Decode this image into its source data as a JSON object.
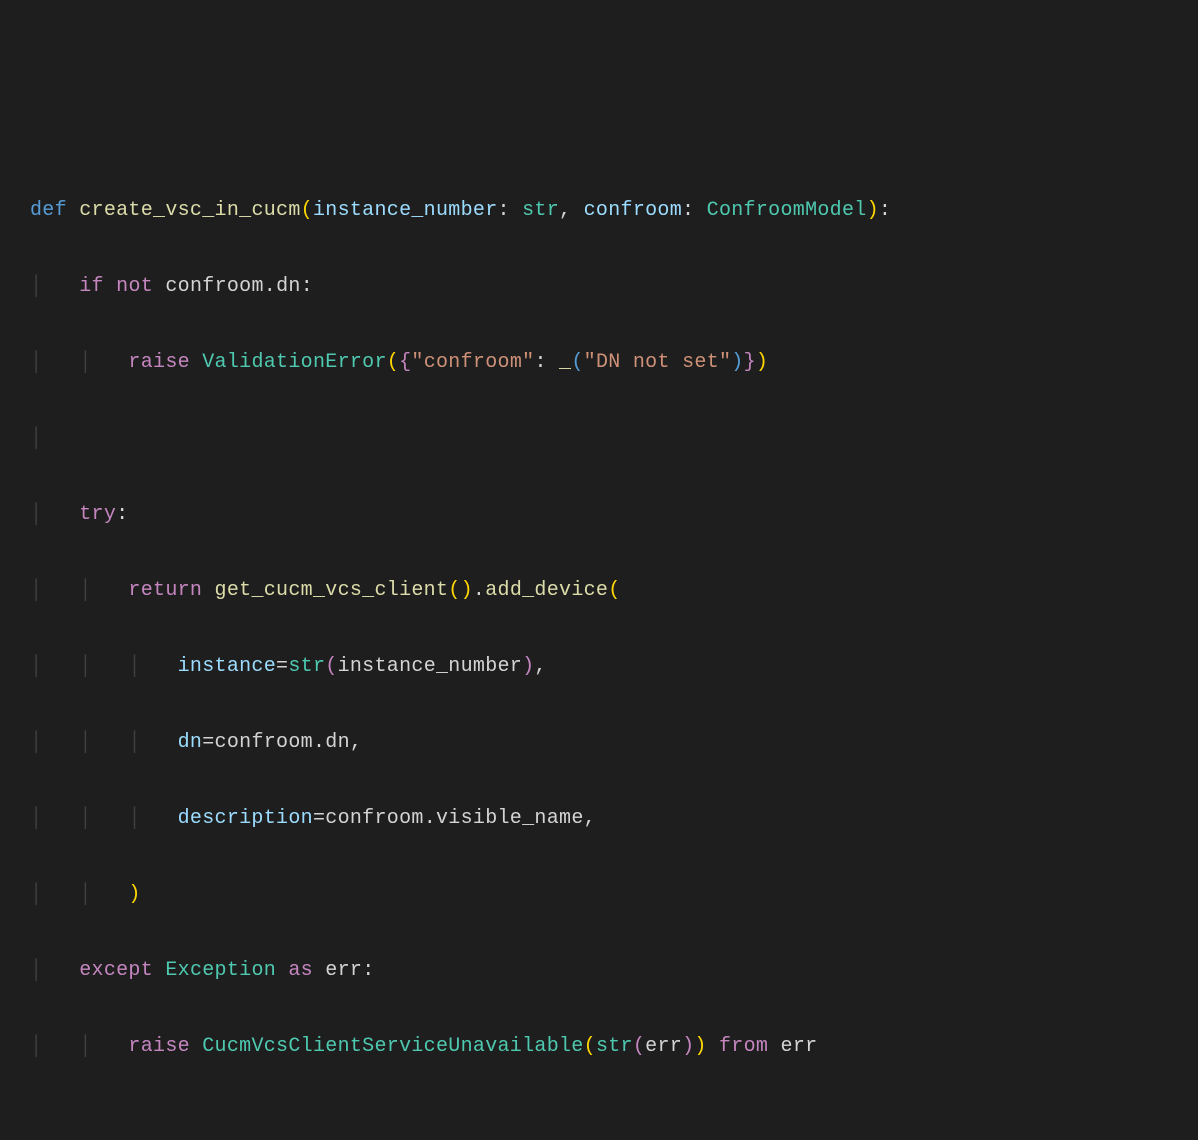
{
  "code": {
    "line1": {
      "def": "def",
      "fn": "create_vsc_in_cucm",
      "p1": "instance_number",
      "t1": "str",
      "p2": "confroom",
      "t2": "ConfroomModel"
    },
    "line2": {
      "if": "if",
      "not": "not",
      "var": "confroom",
      "dot": ".",
      "attr": "dn"
    },
    "line3": {
      "raise": "raise",
      "cls": "ValidationError",
      "key": "\"confroom\"",
      "fn": "_",
      "val": "\"DN not set\""
    },
    "line4": {
      "try": "try"
    },
    "line5": {
      "return": "return",
      "fn1": "get_cucm_vcs_client",
      "fn2": "add_device"
    },
    "line6": {
      "kw": "instance",
      "fn": "str",
      "arg": "instance_number"
    },
    "line7": {
      "kw": "dn",
      "var": "confroom",
      "attr": "dn"
    },
    "line8": {
      "kw": "description",
      "var": "confroom",
      "attr": "visible_name"
    },
    "line9": {
      "except": "except",
      "cls": "Exception",
      "as": "as",
      "var": "err"
    },
    "line10": {
      "raise": "raise",
      "cls": "CucmVcsClientServiceUnavailable",
      "fn": "str",
      "arg": "err",
      "from": "from",
      "var": "err"
    }
  }
}
